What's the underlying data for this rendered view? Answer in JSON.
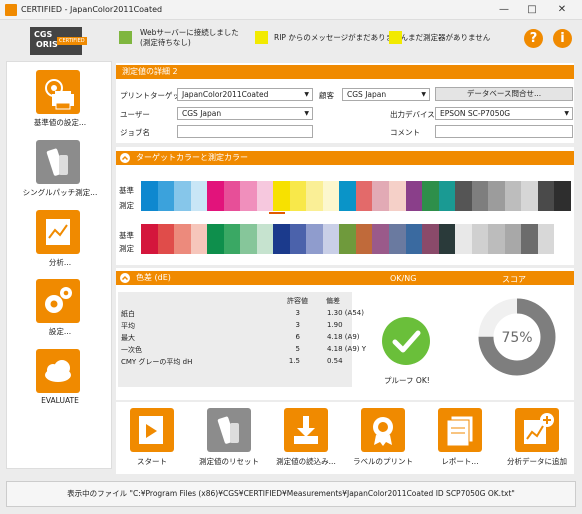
{
  "window": {
    "title": "CERTIFIED - JapanColor2011Coated",
    "min_icon": "minimize-icon",
    "max_icon": "maximize-icon",
    "close_icon": "close-icon"
  },
  "logo": {
    "line1": "CGS",
    "line2": "ORIS",
    "badge": "CERTIFIED"
  },
  "status": {
    "web": {
      "color": "#7fb63f",
      "text1": "Webサーバーに接続しました",
      "text2": "(測定待ちなし)"
    },
    "rip": {
      "color": "#f2ea00",
      "text": "RIP からのメッセージがまだありません"
    },
    "device": {
      "color": "#f2ea00",
      "text": "まだ測定器がありません"
    }
  },
  "help": {
    "question": "?",
    "info": "i"
  },
  "sidebar": [
    {
      "label": "基準値の設定...",
      "icon": "printer-settings-icon"
    },
    {
      "label": "シングルパッチ測定...",
      "icon": "spectro-device-icon"
    },
    {
      "label": "分析...",
      "icon": "analysis-chart-icon"
    },
    {
      "label": "設定...",
      "icon": "gears-icon"
    },
    {
      "label": "EVALUATE",
      "icon": "cloud-icon"
    }
  ],
  "details": {
    "header": "測定値の詳細 2",
    "print_target_label": "プリントターゲット",
    "print_target_value": "JapanColor2011Coated",
    "customer_label": "顧客",
    "customer_value": "CGS Japan",
    "db_button": "データベース問合せ...",
    "user_label": "ユーザー",
    "user_value": "CGS Japan",
    "output_label": "出力デバイス",
    "output_value": "EPSON SC-P7050G",
    "job_label": "ジョブ名",
    "job_value": "",
    "comment_label": "コメント",
    "comment_value": ""
  },
  "colors_section": {
    "header": "ターゲットカラーと測定カラー",
    "ref_label": "基準",
    "meas_label": "測定",
    "row1": [
      "#0e88cf",
      "#3ba2dc",
      "#86c6ea",
      "#c9e6f6",
      "#e2137b",
      "#e74f98",
      "#f08fbc",
      "#f6c8de",
      "#f7e100",
      "#f8e84a",
      "#faef96",
      "#fcf7cd",
      "#0a94c8",
      "#e36a6a",
      "#e2aab5",
      "#f5d0c8",
      "#8a3f8a",
      "#2e8f4a",
      "#1a9a93",
      "#555555",
      "#7e7e7e",
      "#9c9c9c",
      "#bdbdbd",
      "#d6d6d6",
      "#4a4a4a",
      "#2e2e2e"
    ],
    "row2": [
      "#d4163c",
      "#e04c4a",
      "#ec8a7c",
      "#f6c6bb",
      "#0e8f4c",
      "#3aa864",
      "#86c69a",
      "#c6e3cf",
      "#1b3a8c",
      "#4b62ab",
      "#8f9ccd",
      "#c9cfe7",
      "#6f9a3c",
      "#c06a3a",
      "#9a5a8a",
      "#6a7aa0",
      "#3a6aa0",
      "#8a4a6a",
      "#2a3a3a",
      "#e8e8e8",
      "#d0d0d0",
      "#bcbcbc",
      "#a8a8a8",
      "#6c6c6c",
      "#d8d8d8",
      "#ffffff"
    ],
    "marker_color": "#e05a00"
  },
  "delta": {
    "header": "色差 (dE)",
    "okng_header": "OK/NG",
    "score_header": "スコア",
    "col_tolerance": "許容値",
    "col_deviation": "偏差",
    "rows": [
      {
        "label": "紙白",
        "tol": "3",
        "dev": "1.30 (A54)"
      },
      {
        "label": "平均",
        "tol": "3",
        "dev": "1.90"
      },
      {
        "label": "最大",
        "tol": "6",
        "dev": "4.18 (A9)"
      },
      {
        "label": "一次色",
        "tol": "5",
        "dev": "4.18 (A9) Y"
      },
      {
        "label": "CMY グレーの平均 dH",
        "tol": "1.5",
        "dev": "0.54"
      }
    ],
    "ok_text": "プルーフ OK!",
    "ok_color": "#6abf3a",
    "score": 0.75,
    "score_text": "75%"
  },
  "actions": [
    {
      "label": "スタート",
      "icon": "play-document-icon"
    },
    {
      "label": "測定値のリセット",
      "icon": "reset-measurement-icon"
    },
    {
      "label": "測定値の読込み...",
      "icon": "download-icon"
    },
    {
      "label": "ラベルのプリント",
      "icon": "label-print-icon"
    },
    {
      "label": "レポート...",
      "icon": "report-icon"
    },
    {
      "label": "分析データに追加",
      "icon": "add-analysis-icon"
    }
  ],
  "footer": {
    "text": "表示中のファイル \"C:¥Program Files (x86)¥CGS¥CERTIFIED¥Measurements¥JapanColor2011Coated ID SCP7050G OK.txt\""
  }
}
